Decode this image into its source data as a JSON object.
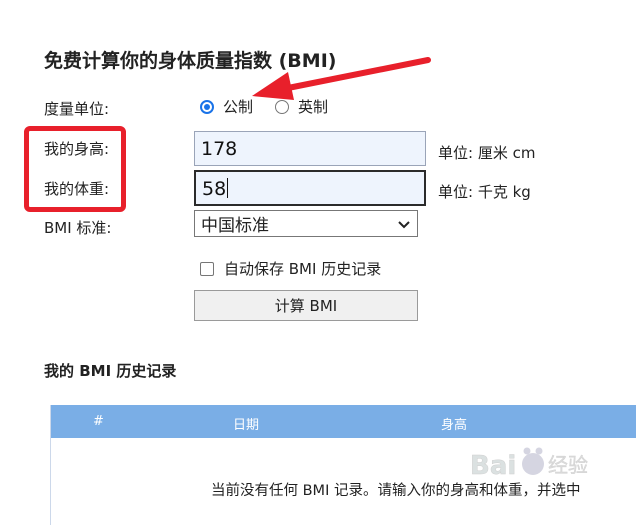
{
  "page": {
    "title": "免费计算你的身体质量指数 (BMI)"
  },
  "form": {
    "unit_label": "度量单位:",
    "unit_options": [
      "公制",
      "英制"
    ],
    "unit_selected": "公制",
    "height_label": "我的身高:",
    "height_value": "178",
    "height_unit": "单位: 厘米 cm",
    "weight_label": "我的体重:",
    "weight_value": "58",
    "weight_unit": "单位: 千克 kg",
    "standard_label": "BMI 标准:",
    "standard_selected": "中国标准",
    "autosave_label": "自动保存 BMI 历史记录",
    "autosave_checked": false,
    "calculate_label": "计算 BMI"
  },
  "history": {
    "title": "我的 BMI 历史记录",
    "columns": [
      "#",
      "日期",
      "身高"
    ],
    "empty_message": "当前没有任何 BMI 记录。请输入你的身高和体重，并选中"
  },
  "annotation": {
    "box_color": "#e8202b",
    "arrow_color": "#e8202b"
  },
  "watermark": {
    "text": "Bai 经验"
  }
}
